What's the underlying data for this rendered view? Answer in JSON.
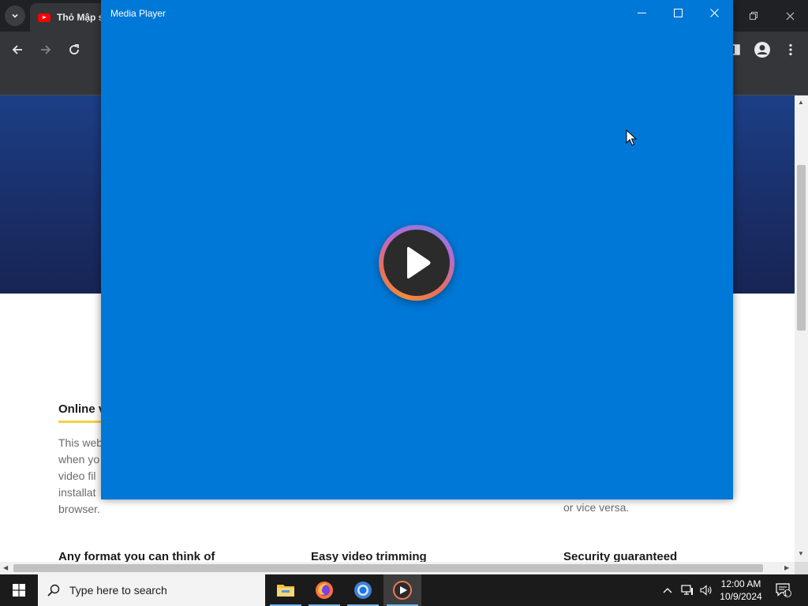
{
  "browser": {
    "tab_title": "Thỏ Mập s",
    "page": {
      "section_title": "Online v",
      "body_lines": [
        "This web",
        "when yo",
        "video fil",
        "installat",
        "browser."
      ],
      "right_text": "or vice versa.",
      "features": [
        "Any format you can think of",
        "Easy video trimming",
        "Security guaranteed"
      ]
    }
  },
  "player": {
    "title": "Media Player"
  },
  "taskbar": {
    "search_placeholder": "Type here to search",
    "clock_time": "12:00 AM",
    "clock_date": "10/9/2024",
    "notification_count": "1",
    "apps": [
      "file-explorer",
      "firefox",
      "chrome",
      "media-player"
    ]
  },
  "colors": {
    "player_bg": "#0078d7",
    "accent": "#76b9ed",
    "hero": "#1c3f86"
  }
}
